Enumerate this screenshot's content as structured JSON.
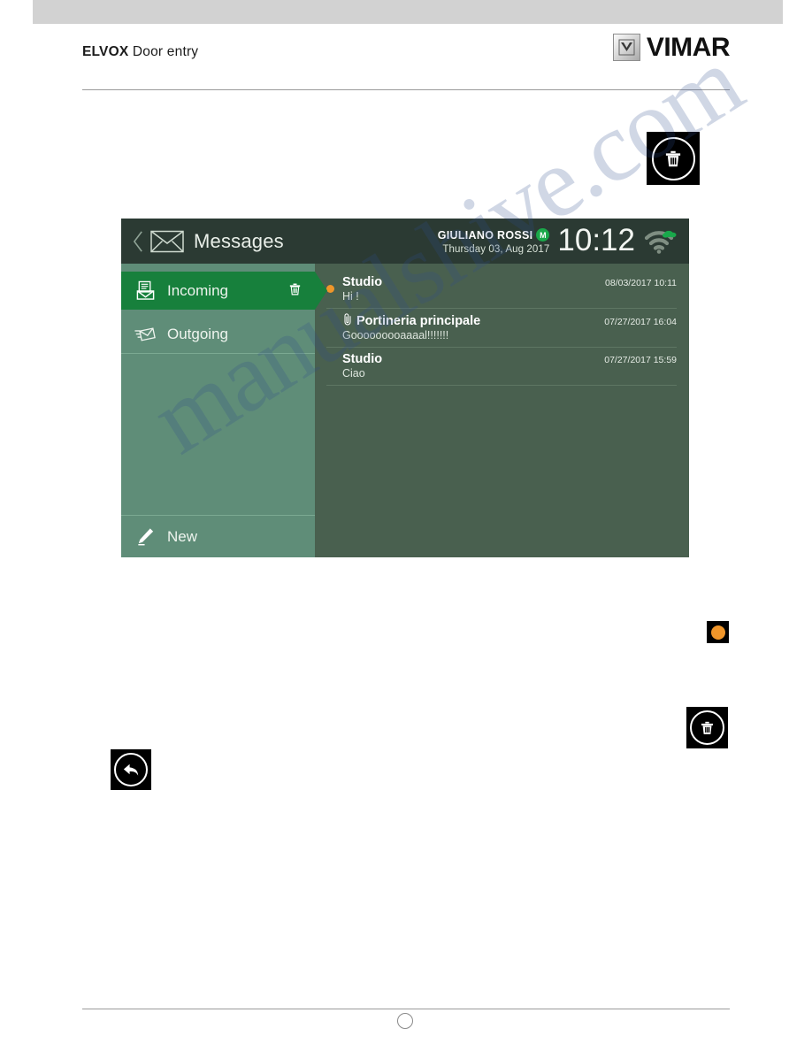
{
  "document": {
    "brand_bold": "ELVOX",
    "brand_rest": " Door entry",
    "logo_text": "VIMAR",
    "watermark": "manualshive.com"
  },
  "annotation_icons": [
    {
      "name": "trash-icon",
      "glyph": "trash",
      "position": "top-right"
    },
    {
      "name": "orange-dot-icon",
      "glyph": "dot",
      "color": "#f0962a",
      "position": "mid-right"
    },
    {
      "name": "trash-icon",
      "glyph": "trash",
      "position": "lower-right"
    },
    {
      "name": "back-arrow-icon",
      "glyph": "back-arrow",
      "position": "lower-left"
    }
  ],
  "device": {
    "header": {
      "back_label": "back",
      "title": "Messages",
      "user_name": "GIULIANO ROSSI",
      "user_badge": "M",
      "date": "Thursday 03, Aug 2017",
      "time": "10:12",
      "wifi_status": "connected",
      "cloud_status": "online"
    },
    "sidebar": {
      "items": [
        {
          "label": "Incoming",
          "icon": "incoming-mail-icon",
          "active": true,
          "has_trash": true
        },
        {
          "label": "Outgoing",
          "icon": "outgoing-mail-icon",
          "active": false,
          "has_trash": false
        }
      ],
      "new_item": {
        "label": "New",
        "icon": "pencil-icon"
      }
    },
    "messages": [
      {
        "sender": "Studio",
        "preview": "Hi !",
        "timestamp": "08/03/2017 10:11",
        "unread": true,
        "attachment": false
      },
      {
        "sender": "Portineria principale",
        "preview": "Gooooooooaaaal!!!!!!!",
        "timestamp": "07/27/2017 16:04",
        "unread": false,
        "attachment": true
      },
      {
        "sender": "Studio",
        "preview": "Ciao",
        "timestamp": "07/27/2017 15:59",
        "unread": false,
        "attachment": false
      }
    ]
  },
  "colors": {
    "header_bar": "#2b3a33",
    "sidebar": "#5f8d78",
    "active_tab": "#17803c",
    "content": "#49604f",
    "accent_orange": "#f0962a",
    "badge_green": "#1aa84a"
  }
}
